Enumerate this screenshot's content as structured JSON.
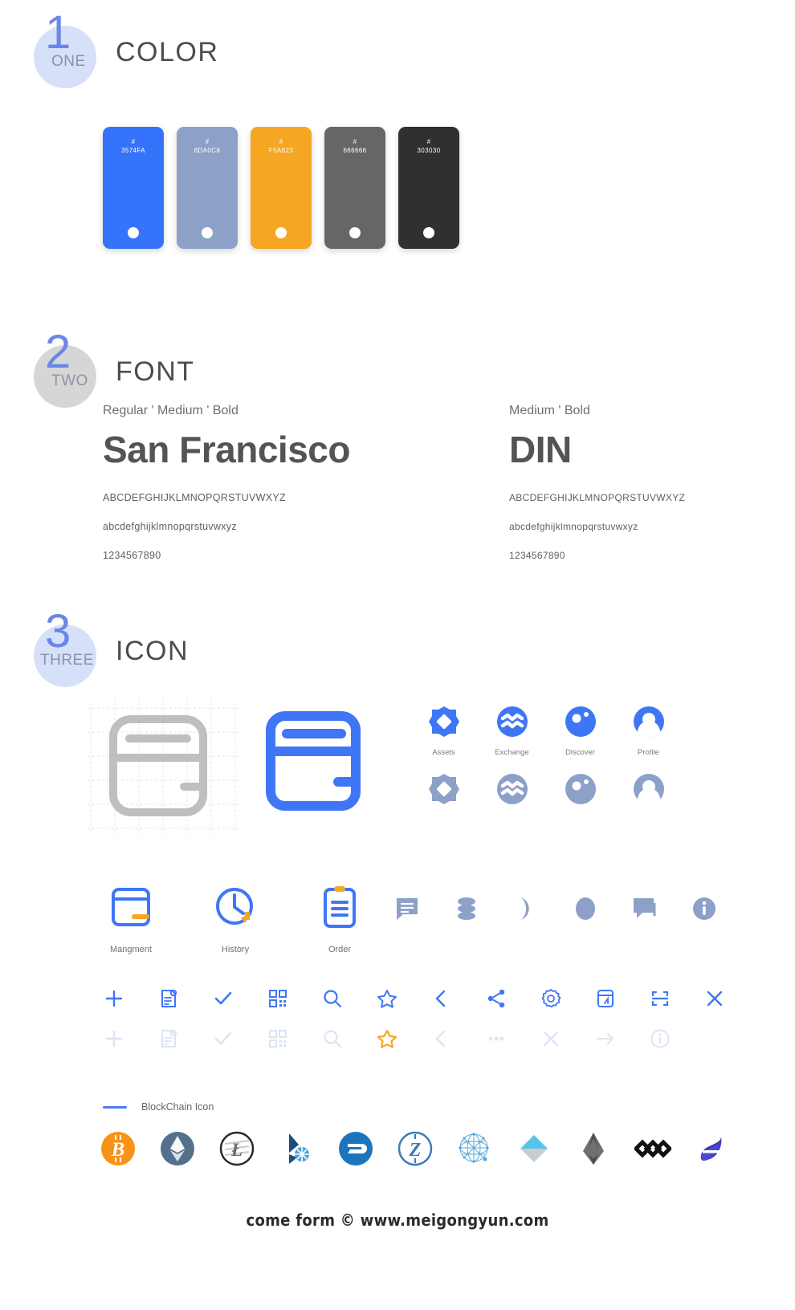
{
  "sections": [
    {
      "num": "1",
      "word": "ONE",
      "title": "COLOR",
      "badge_color": "#d6e0f8"
    },
    {
      "num": "2",
      "word": "TWO",
      "title": "FONT",
      "badge_color": "#d6d6d6"
    },
    {
      "num": "3",
      "word": "THREE",
      "title": "ICON",
      "badge_color": "#d6e0f8"
    }
  ],
  "colors": {
    "swatches": [
      {
        "hash": "#",
        "hex": "3574FA",
        "value": "#3574FA"
      },
      {
        "hash": "#",
        "hex": "8DA0C8",
        "value": "#8DA0C8"
      },
      {
        "hash": "#",
        "hex": "F5A623",
        "value": "#F5A623"
      },
      {
        "hash": "#",
        "hex": "666666",
        "value": "#666666"
      },
      {
        "hash": "#",
        "hex": "303030",
        "value": "#303030"
      }
    ]
  },
  "fonts": [
    {
      "weights": "Regular ' Medium ' Bold",
      "name": "San Francisco",
      "uppercase": "ABCDEFGHIJKLMNOPQRSTUVWXYZ",
      "lowercase": "abcdefghijklmnopqrstuvwxyz",
      "numerals": "1234567890"
    },
    {
      "weights": "Medium ' Bold",
      "name": "DIN",
      "uppercase": "ABCDEFGHIJKLMNOPQRSTUVWXYZ",
      "lowercase": "abcdefghijklmnopqrstuvwxyz",
      "numerals": "1234567890"
    }
  ],
  "icons": {
    "wallet_grid_name": "wallet-construction-grid",
    "wallet_logo_name": "wallet-logo",
    "tabbar": [
      {
        "label": "Assets",
        "icon": "assets-icon"
      },
      {
        "label": "Exchange",
        "icon": "exchange-icon"
      },
      {
        "label": "Discover",
        "icon": "discover-icon"
      },
      {
        "label": "Profile",
        "icon": "profile-icon"
      }
    ],
    "duotone": [
      {
        "label": "Mangment",
        "icon": "wallet-management-icon"
      },
      {
        "label": "History",
        "icon": "history-clock-icon"
      },
      {
        "label": "Order",
        "icon": "order-clipboard-icon"
      }
    ],
    "misc": [
      "message-icon",
      "database-icon",
      "moon-icon",
      "circle-icon",
      "comment-icon",
      "info-icon"
    ],
    "utility_blue": [
      "plus-icon",
      "document-settings-icon",
      "check-icon",
      "qrcode-icon",
      "search-icon",
      "star-icon",
      "chevron-left-icon",
      "share-icon",
      "gear-icon",
      "card-icon",
      "scan-icon",
      "close-icon"
    ],
    "utility_gray": [
      "plus-icon",
      "document-settings-icon",
      "check-icon",
      "qrcode-icon",
      "search-icon",
      "star-filled-icon",
      "chevron-left-icon",
      "ellipsis-icon",
      "close-icon",
      "arrow-right-icon",
      "info-icon"
    ],
    "star_highlight_color": "#F5A623",
    "chain_label": "BlockChain Icon",
    "coins": [
      {
        "name": "bitcoin-icon",
        "color": "#F7931A"
      },
      {
        "name": "ethereum-icon",
        "color": "#54708C"
      },
      {
        "name": "litecoin-icon",
        "color": "#2B2B2B"
      },
      {
        "name": "bitshares-icon",
        "color": "#1F4E79"
      },
      {
        "name": "dash-icon",
        "color": "#1C75BC"
      },
      {
        "name": "zcash-icon",
        "color": "#3A7CB8"
      },
      {
        "name": "qtum-icon",
        "color": "#4B9FD5"
      },
      {
        "name": "waves-icon",
        "color": "#55C4E8"
      },
      {
        "name": "eos-icon",
        "color": "#5B5B5B"
      },
      {
        "name": "nem-icon",
        "color": "#111111"
      },
      {
        "name": "steem-icon",
        "color": "#3A3AB5"
      }
    ]
  },
  "footer": {
    "text": "come form © www.meigongyun.com"
  }
}
